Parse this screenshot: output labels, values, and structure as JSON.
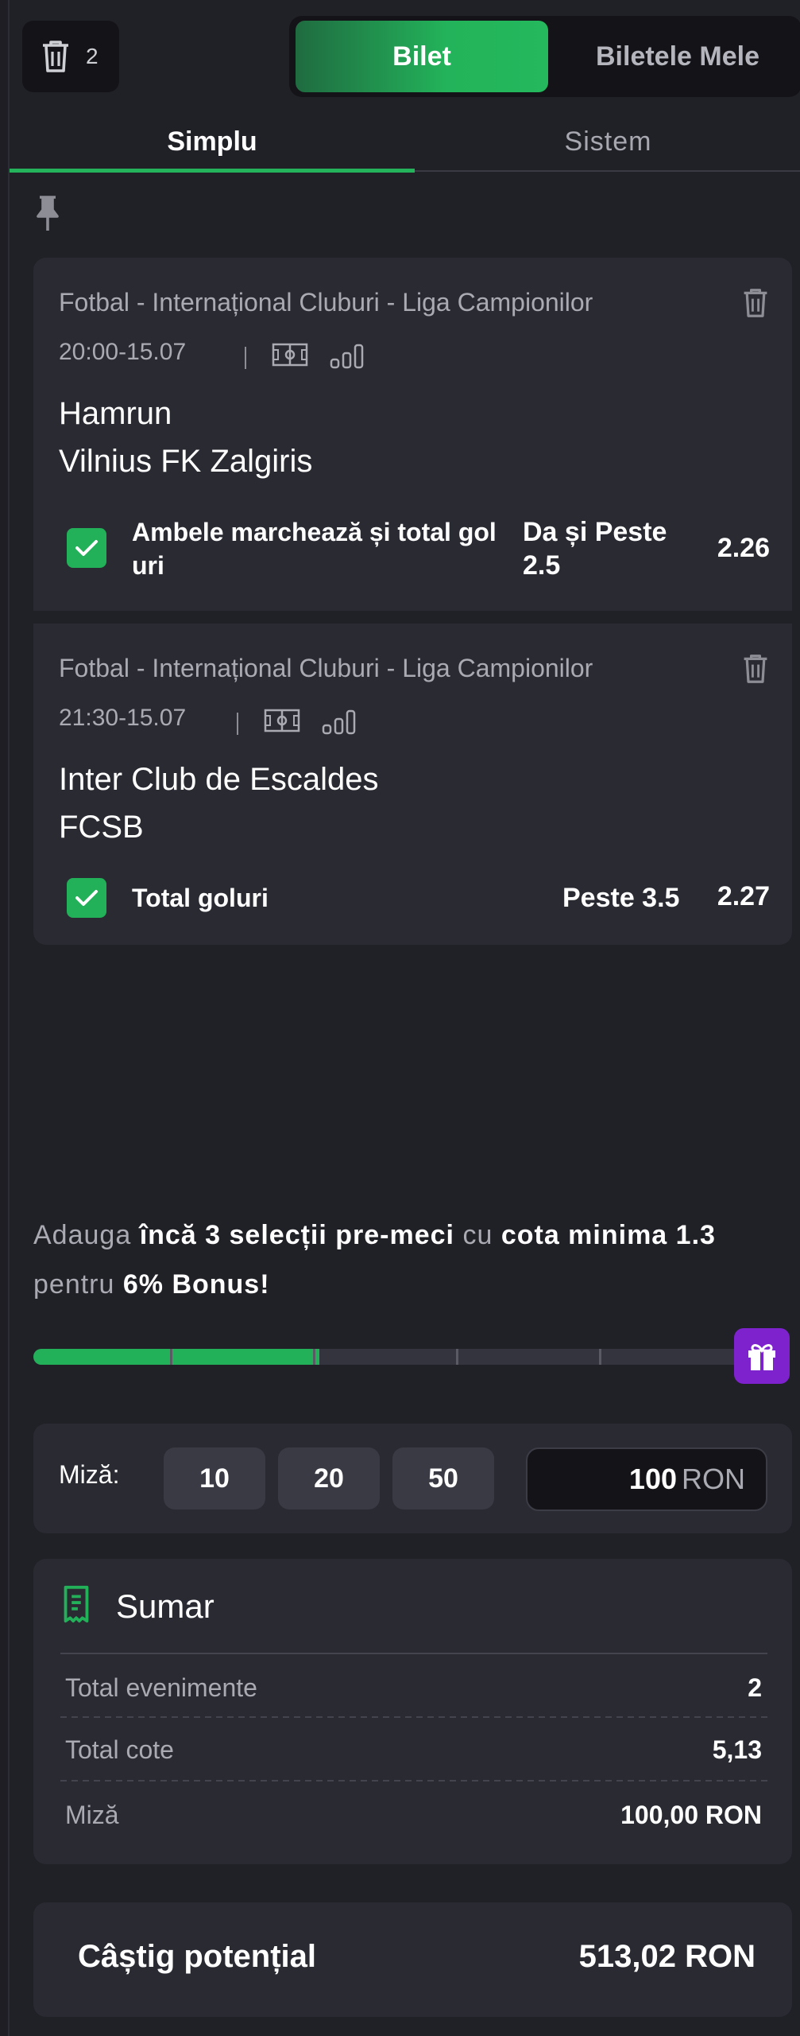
{
  "header": {
    "selection_count": "2",
    "segment": {
      "active": "Bilet",
      "inactive": "Biletele Mele"
    }
  },
  "tabs": [
    {
      "label": "Simplu",
      "active": true
    },
    {
      "label": "Sistem",
      "active": false
    }
  ],
  "events": [
    {
      "league": "Fotbal - Internațional Cluburi - Liga Campionilor",
      "datetime": "20:00-15.07",
      "home": "Hamrun",
      "away": "Vilnius FK Zalgiris",
      "market": "Ambele marchează și total goluri",
      "pick": "Da și Peste 2.5",
      "odd": "2.26"
    },
    {
      "league": "Fotbal - Internațional Cluburi - Liga Campionilor",
      "datetime": "21:30-15.07",
      "home": "Inter Club de Escaldes",
      "away": "FCSB",
      "market": "Total goluri",
      "pick": "Peste 3.5",
      "odd": "2.27"
    }
  ],
  "bonus": {
    "t1": "Adauga",
    "t2": "încă 3 selecții pre-meci",
    "t3": "cu",
    "t4": "cota minima 1.3",
    "t5": "pentru",
    "t6": "6% Bonus!",
    "progress_fraction": 0.4
  },
  "stake": {
    "label": "Miză:",
    "chips": [
      "10",
      "20",
      "50"
    ],
    "value": "100",
    "currency": "RON"
  },
  "summary": {
    "title": "Sumar",
    "rows": [
      {
        "label": "Total evenimente",
        "value": "2"
      },
      {
        "label": "Total cote",
        "value": "5,13"
      },
      {
        "label": "Miză",
        "value": "100,00 RON"
      }
    ]
  },
  "potential": {
    "label": "Câștig potențial",
    "value": "513,02 RON"
  },
  "colors": {
    "accent": "#22b058",
    "background": "#202027",
    "card": "#2a2a33",
    "gift": "#7e22ce"
  }
}
